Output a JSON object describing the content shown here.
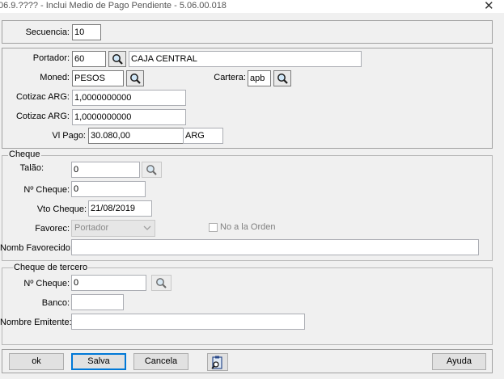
{
  "window": {
    "title": "06.9.???? - Inclui Medio de Pago Pendiente - 5.06.00.018",
    "close_glyph": "✕"
  },
  "secuencia": {
    "label": "Secuencia:",
    "value": "10"
  },
  "portador": {
    "label": "Portador:",
    "code": "60",
    "name": "CAJA CENTRAL"
  },
  "moned": {
    "label": "Moned:",
    "value": "PESOS"
  },
  "cartera": {
    "label": "Cartera:",
    "value": "apb"
  },
  "cotizac1": {
    "label": "Cotizac ARG:",
    "value": "1,0000000000"
  },
  "cotizac2": {
    "label": "Cotizac ARG:",
    "value": "1,0000000000"
  },
  "vl_pago": {
    "label": "Vl Pago:",
    "value": "30.080,00",
    "currency": "ARG"
  },
  "cheque": {
    "legend": "Cheque",
    "talao": {
      "label": "Talão:",
      "value": "0"
    },
    "numero": {
      "label": "Nº Cheque:",
      "value": "0"
    },
    "vto": {
      "label": "Vto Cheque:",
      "value": "21/08/2019"
    },
    "favorec": {
      "label": "Favorec:",
      "value": "Portador"
    },
    "no_orden": {
      "label": "No a la Orden",
      "checked": false
    },
    "nomb_favorecido": {
      "label": "Nomb Favorecido:",
      "value": ""
    }
  },
  "tercero": {
    "legend": "Cheque de tercero",
    "numero": {
      "label": "Nº Cheque:",
      "value": "0"
    },
    "banco": {
      "label": "Banco:",
      "value": ""
    },
    "emitente": {
      "label": "Nombre Emitente:",
      "value": ""
    }
  },
  "buttons": {
    "ok": "ok",
    "salva": "Salva",
    "cancela": "Cancela",
    "ayuda": "Ayuda"
  },
  "icons": {
    "lookup": "magnifier-icon",
    "tool": "clipboard-search-icon"
  },
  "colors": {
    "default_button_border": "#0078d7",
    "window_bg": "#f0f0f0"
  }
}
